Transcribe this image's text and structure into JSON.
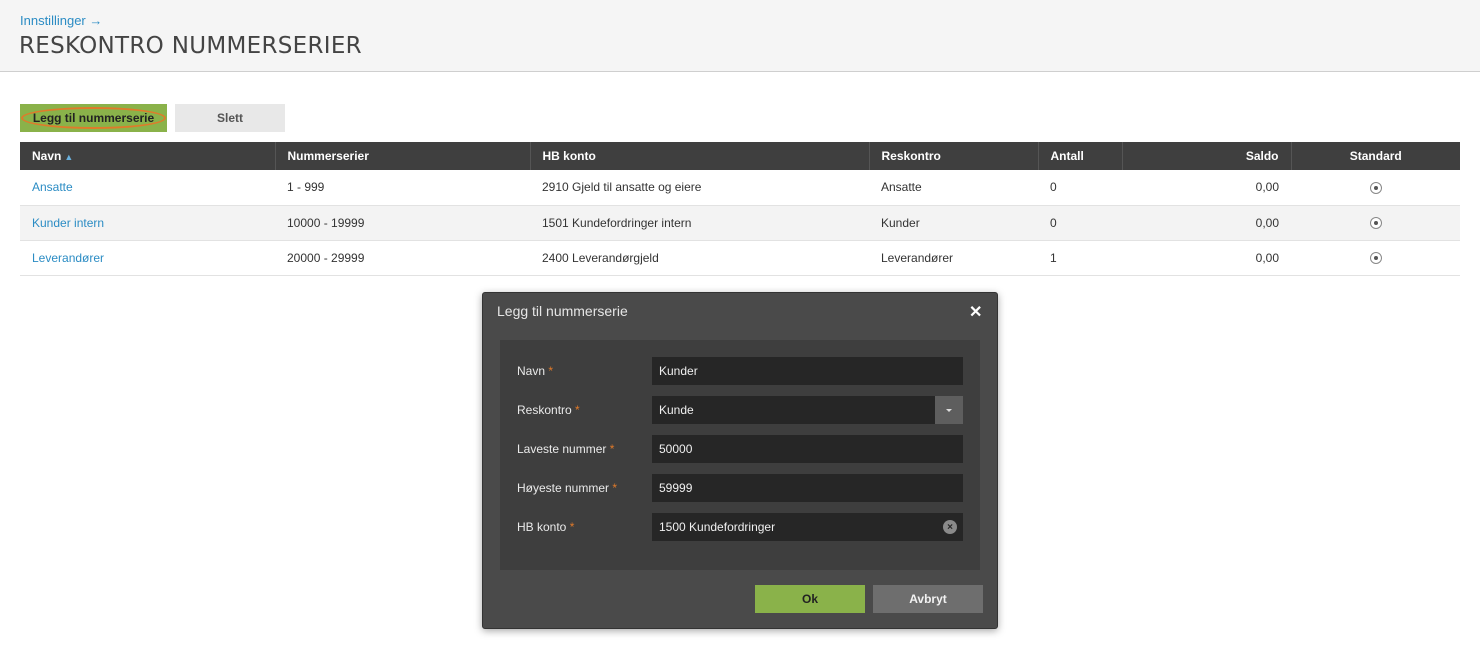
{
  "header": {
    "breadcrumb": "Innstillinger →",
    "title": "RESKONTRO NUMMERSERIER"
  },
  "toolbar": {
    "add_label": "Legg til nummerserie",
    "delete_label": "Slett"
  },
  "table": {
    "columns": [
      "Navn",
      "Nummerserier",
      "HB konto",
      "Reskontro",
      "Antall",
      "Saldo",
      "Standard"
    ],
    "sort_indicator": "▲",
    "rows": [
      {
        "navn": "Ansatte",
        "nummerserier": "1 - 999",
        "hb_konto": "2910 Gjeld til ansatte og eiere",
        "reskontro": "Ansatte",
        "antall": "0",
        "saldo": "0,00"
      },
      {
        "navn": "Kunder intern",
        "nummerserier": "10000 - 19999",
        "hb_konto": "1501 Kundefordringer intern",
        "reskontro": "Kunder",
        "antall": "0",
        "saldo": "0,00"
      },
      {
        "navn": "Leverandører",
        "nummerserier": "20000 - 29999",
        "hb_konto": "2400 Leverandørgjeld",
        "reskontro": "Leverandører",
        "antall": "1",
        "saldo": "0,00"
      }
    ]
  },
  "dialog": {
    "title": "Legg til nummerserie",
    "close_glyph": "✕",
    "required_mark": "*",
    "fields": [
      {
        "label": "Navn",
        "value": "Kunder"
      },
      {
        "label": "Reskontro",
        "value": "Kunde"
      },
      {
        "label": "Laveste nummer",
        "value": "50000"
      },
      {
        "label": "Høyeste nummer",
        "value": "59999"
      },
      {
        "label": "HB konto",
        "value": "1500 Kundefordringer"
      }
    ],
    "ok_label": "Ok",
    "cancel_label": "Avbryt"
  },
  "colors": {
    "accent_green": "#8ab24a",
    "link_blue": "#2b8cc4",
    "required_orange": "#e07a2a",
    "header_dark": "#3f3f3f"
  }
}
